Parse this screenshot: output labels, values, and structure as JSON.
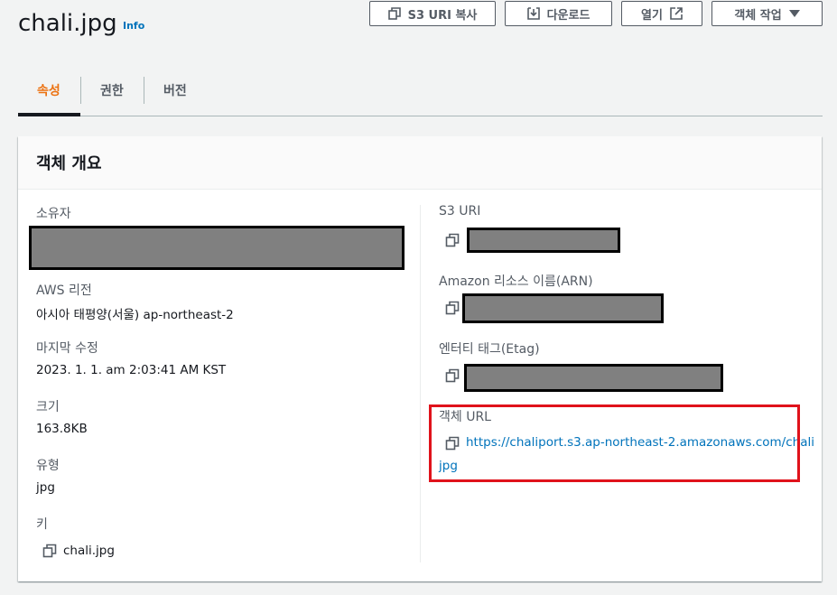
{
  "header": {
    "title": "chali.jpg",
    "info_label": "Info",
    "buttons": {
      "copy_s3_uri": "S3 URI 복사",
      "download": "다운로드",
      "open": "열기",
      "object_actions": "객체 작업"
    }
  },
  "tabs": [
    {
      "label": "속성",
      "active": true
    },
    {
      "label": "권한",
      "active": false
    },
    {
      "label": "버전",
      "active": false
    }
  ],
  "panel": {
    "title": "객체 개요",
    "left": {
      "owner_label": "소유자",
      "region_label": "AWS 리전",
      "region_value": "아시아 태평양(서울) ap-northeast-2",
      "modified_label": "마지막 수정",
      "modified_value": "2023. 1. 1. am 2:03:41 AM KST",
      "size_label": "크기",
      "size_value": "163.8KB",
      "type_label": "유형",
      "type_value": "jpg",
      "key_label": "키",
      "key_value": "chali.jpg"
    },
    "right": {
      "s3_uri_label": "S3 URI",
      "arn_label": "Amazon 리소스 이름(ARN)",
      "etag_label": "엔터티 태그(Etag)",
      "object_url_label": "객체 URL",
      "object_url_line1": "https://chaliport.s3.ap-northeast-2.amazonaws.com/chali",
      "object_url_line2": "jpg"
    }
  },
  "icons": {
    "copy": "copy-icon",
    "download": "download-icon",
    "external": "external-link-icon",
    "caret": "caret-down-icon"
  },
  "colors": {
    "accent_tab": "#ec7211",
    "link": "#0073bb",
    "highlight_box": "#e0121b",
    "redaction_fill": "#808080"
  }
}
